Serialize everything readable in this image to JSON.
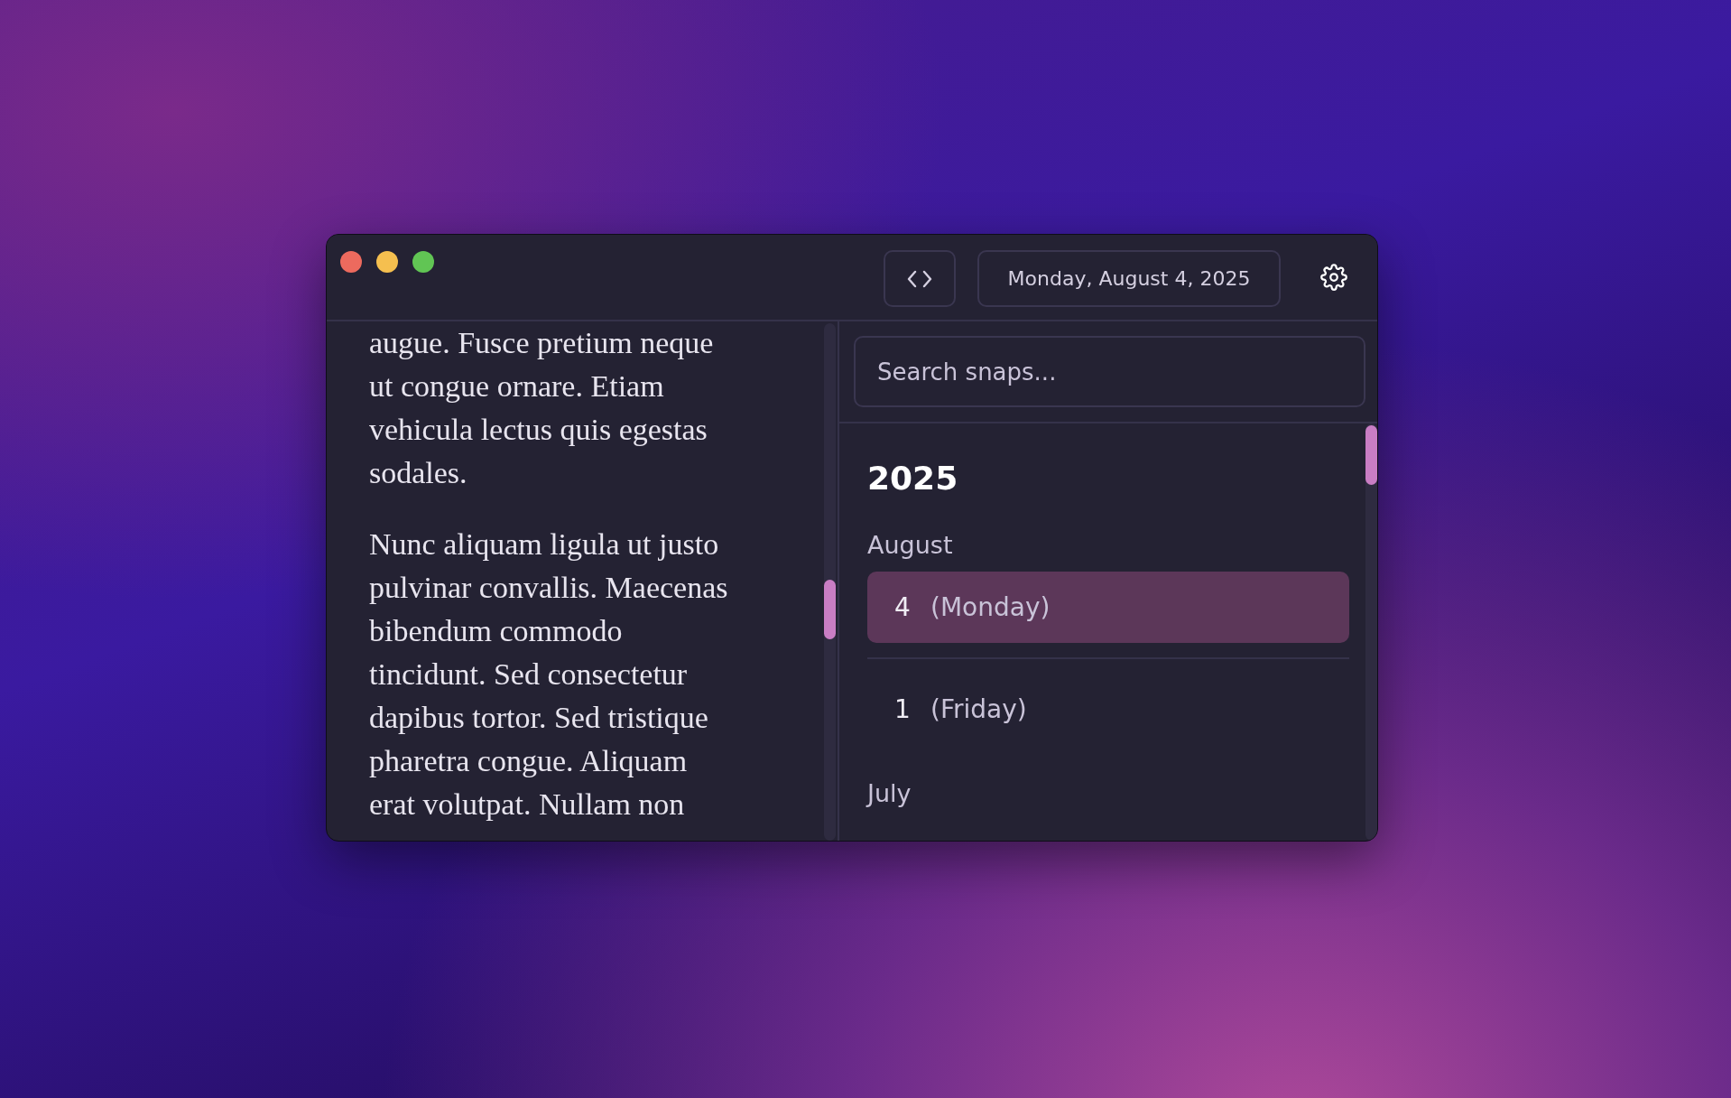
{
  "toolbar": {
    "date": "Monday, August 4, 2025"
  },
  "editor": {
    "paragraphs": [
      {
        "lines": [
          "augue. Fusce pretium neque",
          "ut congue ornare. Etiam",
          "vehicula lectus quis egestas",
          "sodales."
        ]
      },
      {
        "lines": [
          "Nunc aliquam ligula ut justo",
          "pulvinar convallis. Maecenas",
          "bibendum commodo",
          "tincidunt. Sed consectetur",
          "dapibus tortor. Sed tristique",
          "pharetra congue. Aliquam",
          "erat volutpat. Nullam non"
        ]
      }
    ]
  },
  "sidebar": {
    "search": {
      "placeholder": "Search snaps..."
    },
    "years": [
      {
        "year": "2025",
        "months": [
          {
            "name": "August",
            "days": [
              {
                "day": "4",
                "weekday": "(Monday)",
                "selected": true
              },
              {
                "day": "1",
                "weekday": "(Friday)",
                "selected": false
              }
            ]
          },
          {
            "name": "July"
          }
        ]
      }
    ]
  }
}
